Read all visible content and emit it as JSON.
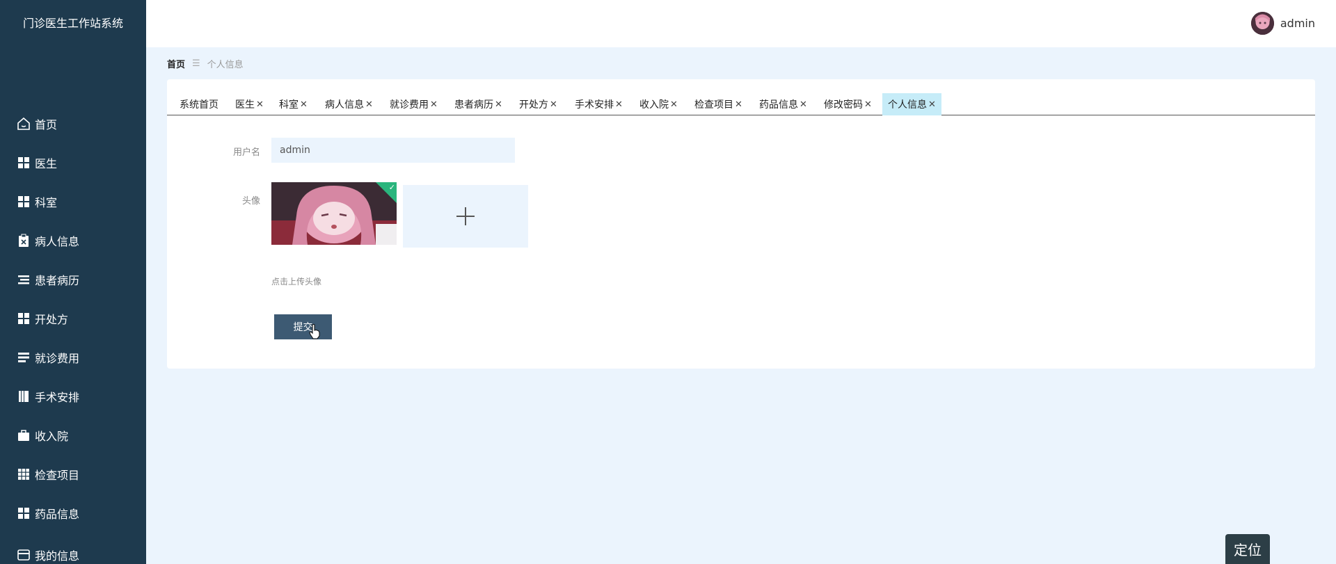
{
  "app": {
    "title": "门诊医生工作站系统"
  },
  "header": {
    "username": "admin"
  },
  "sidebar": {
    "items": [
      {
        "label": "首页",
        "icon": "home-icon"
      },
      {
        "label": "医生",
        "icon": "grid-icon"
      },
      {
        "label": "科室",
        "icon": "grid-icon"
      },
      {
        "label": "病人信息",
        "icon": "clipboard-icon"
      },
      {
        "label": "患者病历",
        "icon": "list-icon"
      },
      {
        "label": "开处方",
        "icon": "grid-icon"
      },
      {
        "label": "就诊费用",
        "icon": "bars-icon"
      },
      {
        "label": "手术安排",
        "icon": "book-icon"
      },
      {
        "label": "收入院",
        "icon": "briefcase-icon"
      },
      {
        "label": "检查项目",
        "icon": "apps-icon"
      },
      {
        "label": "药品信息",
        "icon": "grid-icon"
      },
      {
        "label": "我的信息",
        "icon": "wallet-icon"
      }
    ]
  },
  "breadcrumb": {
    "home": "首页",
    "separator": "☰",
    "current": "个人信息"
  },
  "tabs": [
    {
      "label": "系统首页",
      "closable": false,
      "active": false
    },
    {
      "label": "医生",
      "closable": true,
      "active": false
    },
    {
      "label": "科室",
      "closable": true,
      "active": false
    },
    {
      "label": "病人信息",
      "closable": true,
      "active": false
    },
    {
      "label": "就诊费用",
      "closable": true,
      "active": false
    },
    {
      "label": "患者病历",
      "closable": true,
      "active": false
    },
    {
      "label": "开处方",
      "closable": true,
      "active": false
    },
    {
      "label": "手术安排",
      "closable": true,
      "active": false
    },
    {
      "label": "收入院",
      "closable": true,
      "active": false
    },
    {
      "label": "检查项目",
      "closable": true,
      "active": false
    },
    {
      "label": "药品信息",
      "closable": true,
      "active": false
    },
    {
      "label": "修改密码",
      "closable": true,
      "active": false
    },
    {
      "label": "个人信息",
      "closable": true,
      "active": true
    }
  ],
  "form": {
    "username_label": "用户名",
    "username_value": "admin",
    "avatar_label": "头像",
    "upload_hint": "点击上传头像",
    "submit_label": "提交"
  },
  "floating": {
    "locate_label": "定位"
  },
  "colors": {
    "sidebar_bg": "#1e3a4e",
    "page_bg": "#ebf4fd",
    "active_tab": "#c6ecf8",
    "submit_bg": "#3d5a73",
    "success_corner": "#2ab57d"
  }
}
